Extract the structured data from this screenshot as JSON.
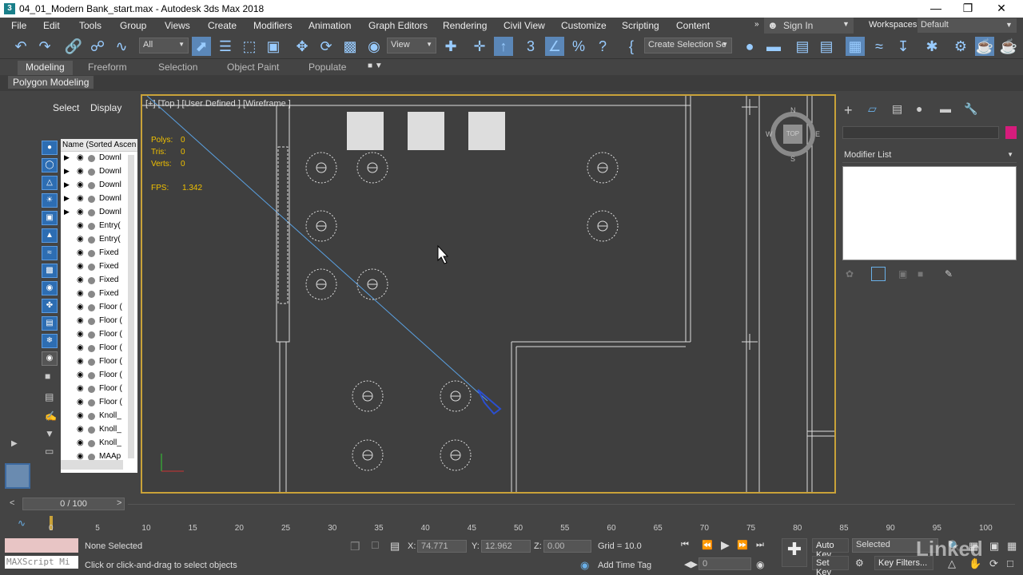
{
  "titlebar": {
    "title": "04_01_Modern Bank_start.max - Autodesk 3ds Max 2018",
    "app_icon": "3"
  },
  "menu": [
    "File",
    "Edit",
    "Tools",
    "Group",
    "Views",
    "Create",
    "Modifiers",
    "Animation",
    "Graph Editors",
    "Rendering",
    "Civil View",
    "Customize",
    "Scripting",
    "Content"
  ],
  "signin": "Sign In",
  "workspaces_label": "Workspaces:",
  "workspaces_value": "Default",
  "toolbar": {
    "filter": "All",
    "refcoord": "View",
    "selection_set": "Create Selection Se"
  },
  "ribbon_tabs": [
    "Modeling",
    "Freeform",
    "Selection",
    "Object Paint",
    "Populate"
  ],
  "ribbon_sub": "Polygon Modeling",
  "scene_explorer": {
    "tabs": [
      "Select",
      "Display"
    ],
    "header": "Name (Sorted Ascen",
    "rows": [
      {
        "name": "Downl",
        "expand": true
      },
      {
        "name": "Downl",
        "expand": true
      },
      {
        "name": "Downl",
        "expand": true
      },
      {
        "name": "Downl",
        "expand": true
      },
      {
        "name": "Downl",
        "expand": true
      },
      {
        "name": "Entry(",
        "expand": false
      },
      {
        "name": "Entry(",
        "expand": false
      },
      {
        "name": "Fixed",
        "expand": false
      },
      {
        "name": "Fixed",
        "expand": false
      },
      {
        "name": "Fixed",
        "expand": false
      },
      {
        "name": "Fixed",
        "expand": false
      },
      {
        "name": "Floor (",
        "expand": false
      },
      {
        "name": "Floor (",
        "expand": false
      },
      {
        "name": "Floor (",
        "expand": false
      },
      {
        "name": "Floor (",
        "expand": false
      },
      {
        "name": "Floor (",
        "expand": false
      },
      {
        "name": "Floor (",
        "expand": false
      },
      {
        "name": "Floor (",
        "expand": false
      },
      {
        "name": "Floor (",
        "expand": false
      },
      {
        "name": "Knoll_",
        "expand": false
      },
      {
        "name": "Knoll_",
        "expand": false
      },
      {
        "name": "Knoll_",
        "expand": false
      },
      {
        "name": "MAAp",
        "expand": false
      }
    ]
  },
  "viewport": {
    "label": "[+] [Top ] [User Defined ] [Wireframe ]",
    "stats": [
      {
        "label": "Polys:",
        "value": "0"
      },
      {
        "label": "Tris:",
        "value": "0"
      },
      {
        "label": "Verts:",
        "value": "0"
      }
    ],
    "fps_label": "FPS:",
    "fps_value": "1.342",
    "viewcube": {
      "n": "N",
      "s": "S",
      "e": "E",
      "w": "W",
      "face": "TOP"
    }
  },
  "command_panel": {
    "modifier_list": "Modifier List"
  },
  "timeline": {
    "frame": "0 / 100",
    "ticks": [
      "0",
      "5",
      "10",
      "15",
      "20",
      "25",
      "30",
      "35",
      "40",
      "45",
      "50",
      "55",
      "60",
      "65",
      "70",
      "75",
      "80",
      "85",
      "90",
      "95",
      "100"
    ]
  },
  "status": {
    "selection": "None Selected",
    "prompt": "Click or click-and-drag to select objects",
    "maxscript": "MAXScript Mi",
    "x_label": "X:",
    "x_value": "74.771",
    "y_label": "Y:",
    "y_value": "12.962",
    "z_label": "Z:",
    "z_value": "0.00",
    "grid": "Grid = 10.0",
    "add_time_tag": "Add Time Tag",
    "auto_key": "Auto Key",
    "selected": "Selected",
    "set_key": "Set Key",
    "key_filters": "Key Filters...",
    "frame_field": "0"
  },
  "watermark": "Linked"
}
